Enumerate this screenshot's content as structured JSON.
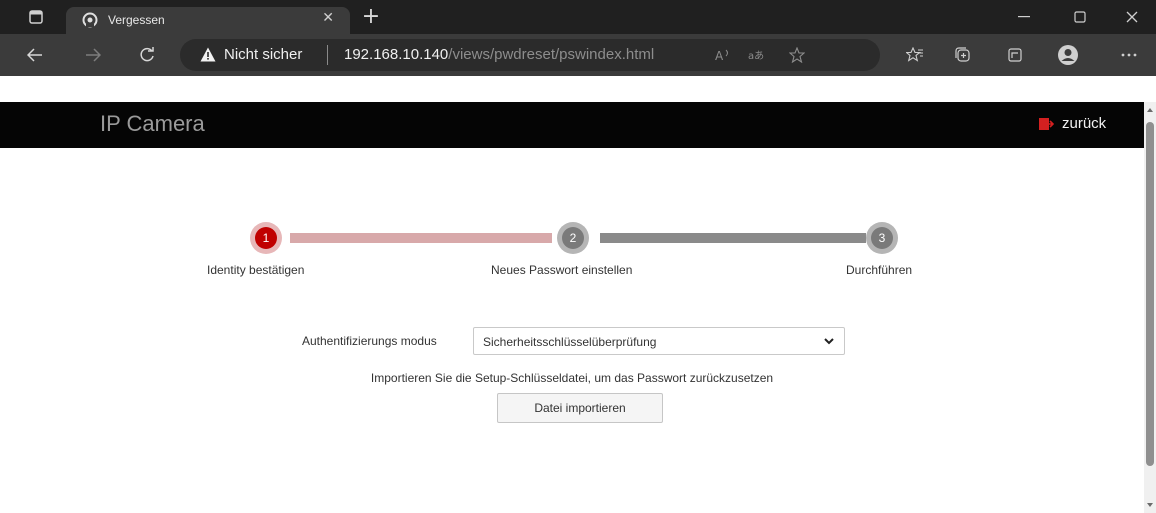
{
  "browser": {
    "tab": {
      "title": "Vergessen"
    },
    "address": {
      "security_label": "Nicht sicher",
      "url_host": "192.168.10.140",
      "url_path": "/views/pwdreset/pswindex.html"
    },
    "toolbar_icons": [
      "read-aloud-icon",
      "translate-icon",
      "favorite-star-icon",
      "favorites-icon",
      "collections-icon",
      "browser-essentials-icon",
      "profile-icon",
      "more-icon"
    ]
  },
  "app": {
    "brand": "IP Camera",
    "back_label": "zurück"
  },
  "steps": [
    {
      "number": "1",
      "label": "Identity bestätigen",
      "state": "active"
    },
    {
      "number": "2",
      "label": "Neues Passwort einstellen",
      "state": "pending"
    },
    {
      "number": "3",
      "label": "Durchführen",
      "state": "pending"
    }
  ],
  "form": {
    "auth_mode_label": "Authentifizierungs modus",
    "auth_mode_value": "Sicherheitsschlüsselüberprüfung",
    "hint": "Importieren Sie die Setup-Schlüsseldatei, um das Passwort zurückzusetzen",
    "import_button": "Datei importieren"
  },
  "colors": {
    "active_step": "#c00000",
    "pending_step": "#7a7a7a",
    "progress_done": "#d8a9aa",
    "progress_pending": "#8a8a8a",
    "header_bg": "#050505"
  }
}
